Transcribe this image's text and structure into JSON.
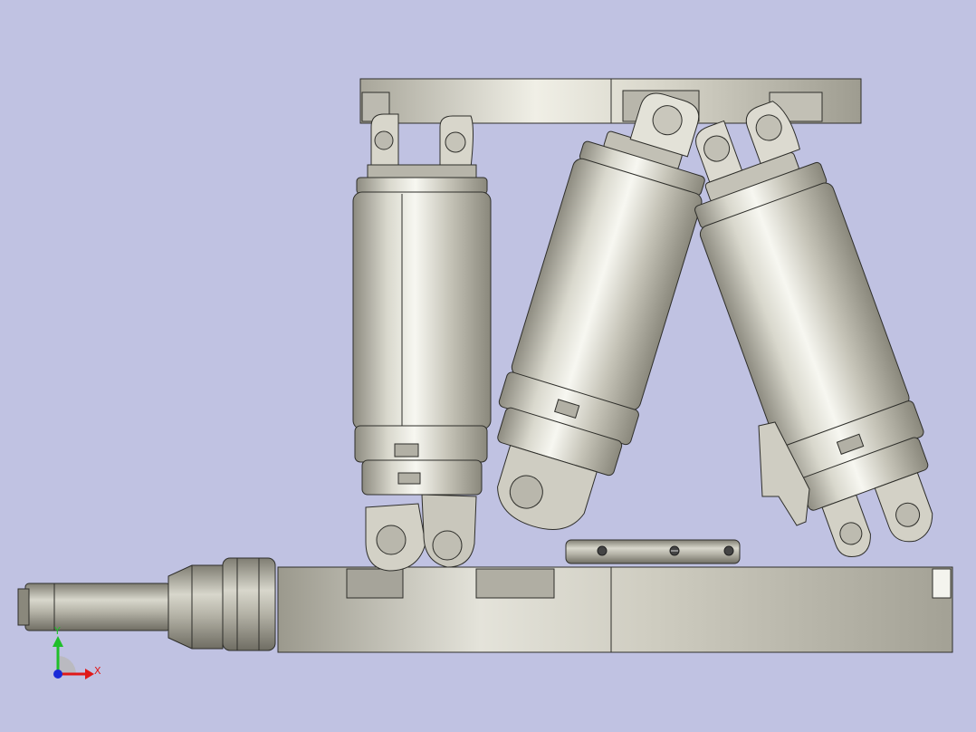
{
  "viewport": {
    "background": "#c0c2e2"
  },
  "model": {
    "metal_light": "#f2f2ea",
    "metal_mid": "#c9c7ba",
    "metal_dark": "#8a887c",
    "edge": "#2e2e2a"
  },
  "triad": {
    "y_label": "Y",
    "x_label": "X",
    "y_color": "#1fbf2a",
    "x_color": "#e01818",
    "z_color": "#1a2ad8"
  }
}
